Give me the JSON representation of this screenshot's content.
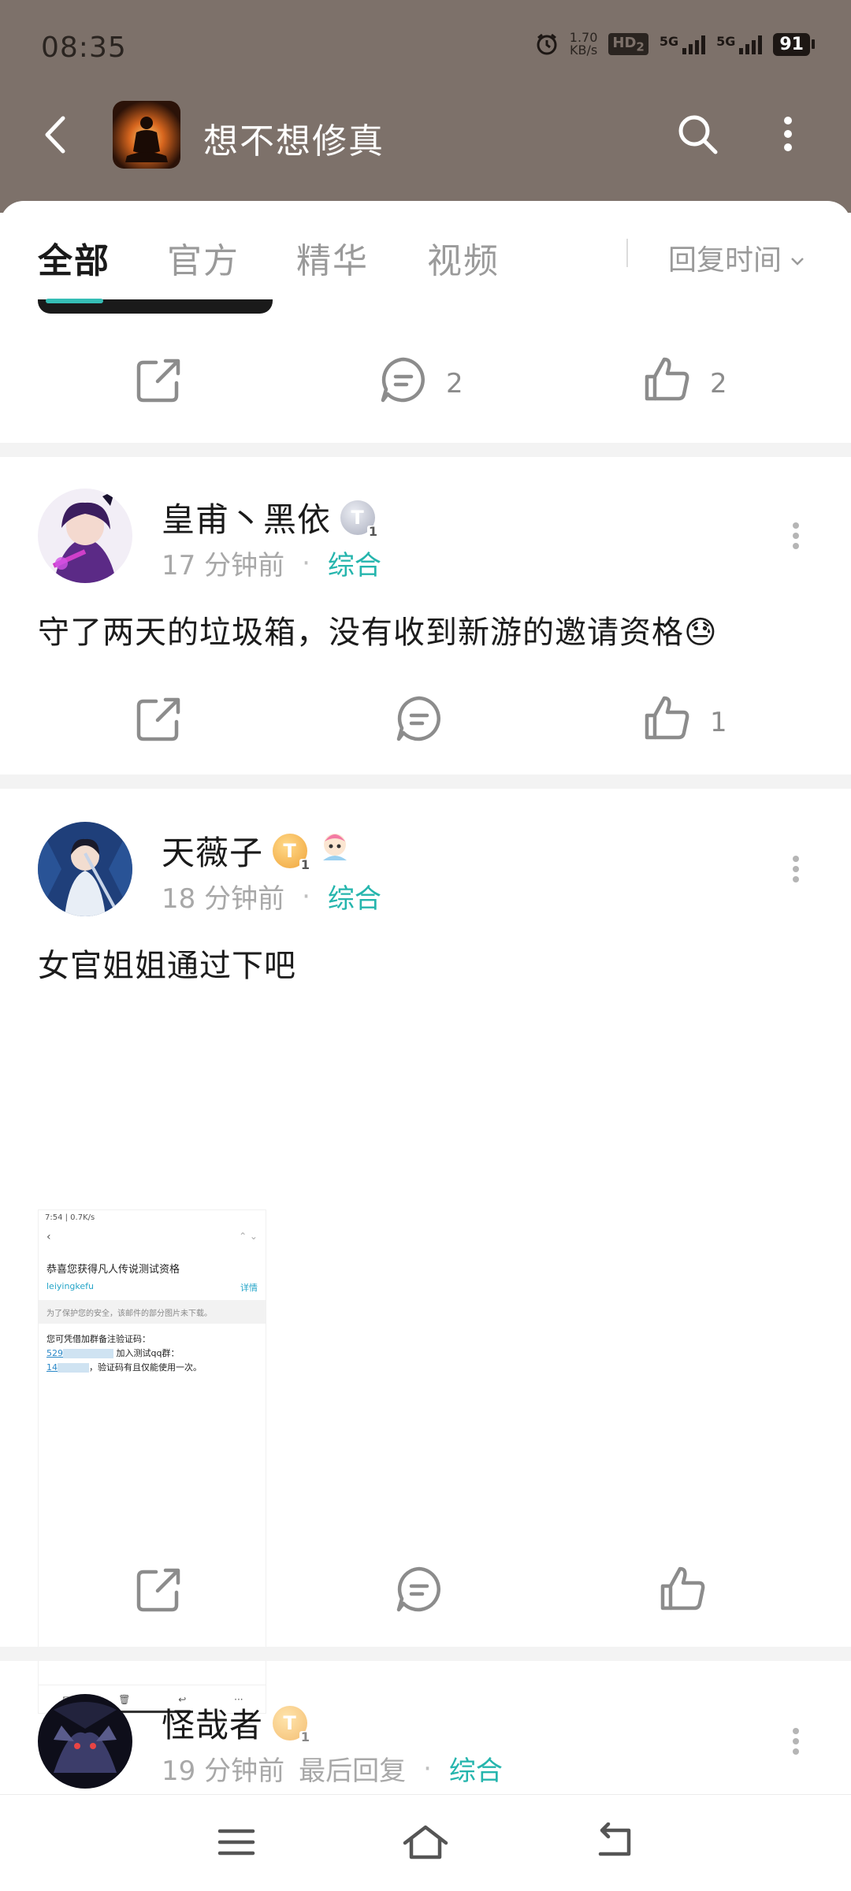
{
  "status_bar": {
    "time": "08:35",
    "net_speed_value": "1.70",
    "net_speed_unit": "KB/s",
    "hd_label": "HD",
    "hd_sub": "2",
    "sig1_label": "5G",
    "sig2_label": "5G",
    "battery": "91"
  },
  "header": {
    "title": "想不想修真",
    "back_icon": "back-arrow-icon",
    "search_icon": "search-icon",
    "more_icon": "more-vertical-icon"
  },
  "tabs": {
    "items": [
      "全部",
      "官方",
      "精华",
      "视频"
    ],
    "active_index": 0,
    "sort_label": "回复时间"
  },
  "colors": {
    "accent": "#25b5ad",
    "header_bg": "#7d716a"
  },
  "posts": [
    {
      "share_icon": "share-icon",
      "comment_count": "2",
      "like_count": "2"
    },
    {
      "username": "皇甫丶黑依",
      "level": "T",
      "level_sub": "1",
      "time": "17 分钟前",
      "separator": "·",
      "category": "综合",
      "text": "守了两天的垃圾箱，没有收到新游的邀请资格😓",
      "comment_count": "",
      "like_count": "1"
    },
    {
      "username": "天薇子",
      "level": "T",
      "level_sub": "1",
      "time": "18 分钟前",
      "separator": "·",
      "category": "综合",
      "text": "女官姐姐通过下吧",
      "comment_count": "",
      "like_count": "",
      "image": {
        "status": "7:54 | 0.7K/s",
        "title": "恭喜您获得凡人传说测试资格",
        "sender": "leiyingkefu",
        "detail": "详情",
        "warning": "为了保护您的安全，该邮件的部分图片未下载。",
        "body_line1": "您可凭借加群备注验证码：",
        "code_prefix": "529",
        "join_text": "加入测试qq群：",
        "group_prefix": "14",
        "body_tail": "，验证码有且仅能使用一次。"
      }
    },
    {
      "username": "怪哉者",
      "level": "T",
      "level_sub": "1",
      "time": "19 分钟前",
      "last_reply": "最后回复",
      "separator": "·",
      "category": "综合"
    }
  ],
  "system_nav": {
    "menu_icon": "menu-icon",
    "home_icon": "home-icon",
    "back_icon": "back-icon"
  }
}
